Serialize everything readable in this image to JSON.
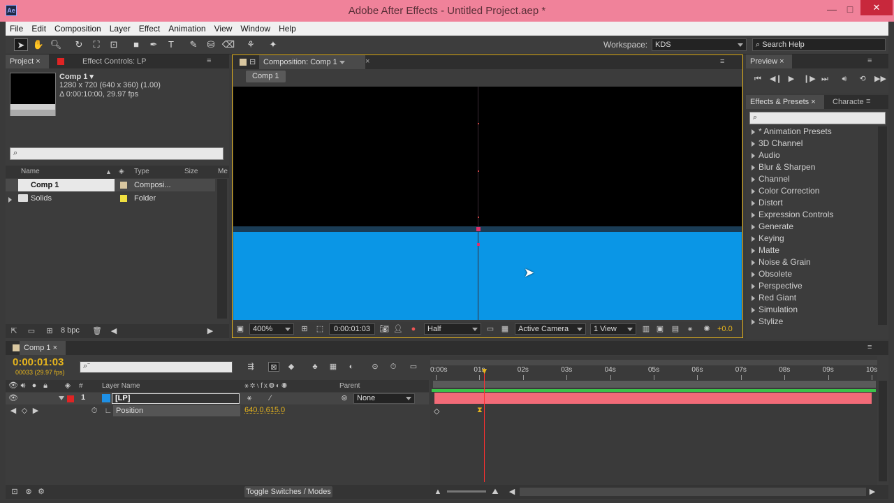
{
  "window": {
    "title": "Adobe After Effects - Untitled Project.aep *",
    "app_icon": "Ae"
  },
  "menu": [
    "File",
    "Edit",
    "Composition",
    "Layer",
    "Effect",
    "Animation",
    "View",
    "Window",
    "Help"
  ],
  "toolbar": {
    "workspace_label": "Workspace:",
    "workspace_value": "KDS",
    "search_placeholder": "Search Help"
  },
  "project_panel": {
    "tab_project": "Project",
    "tab_effect_controls": "Effect Controls: LP",
    "comp_name": "Comp 1 ▾",
    "comp_size": "1280 x 720  (640 x 360) (1.00)",
    "comp_duration": "Δ 0:00:10:00, 29.97 fps",
    "search_placeholder": "⌕",
    "columns": {
      "name": "Name",
      "type": "Type",
      "size": "Size",
      "media": "Me"
    },
    "items": [
      {
        "name": "Comp 1",
        "type": "Composi...",
        "label_color": "#d9c7a0"
      },
      {
        "name": "Solids",
        "type": "Folder",
        "label_color": "#f0e040"
      }
    ],
    "bpc": "8 bpc"
  },
  "composition_panel": {
    "tab": "Composition: Comp 1",
    "crumb": "Comp 1",
    "zoom": "400%",
    "timecode": "0:00:01:03",
    "resolution": "Half",
    "camera": "Active Camera",
    "views": "1 View",
    "exposure": "+0.0",
    "fill_color": "#0a96e6"
  },
  "preview_panel": {
    "tab": "Preview"
  },
  "effects_panel": {
    "tab": "Effects & Presets",
    "tab2": "Characte",
    "search_placeholder": "⌕",
    "items": [
      "* Animation Presets",
      "3D Channel",
      "Audio",
      "Blur & Sharpen",
      "Channel",
      "Color Correction",
      "Distort",
      "Expression Controls",
      "Generate",
      "Keying",
      "Matte",
      "Noise & Grain",
      "Obsolete",
      "Perspective",
      "Red Giant",
      "Simulation",
      "Stylize"
    ]
  },
  "timeline": {
    "tab": "Comp 1",
    "timecode": "0:00:01:03",
    "frame_info": "00033 (29.97 fps)",
    "columns": {
      "num": "#",
      "layer_name": "Layer Name",
      "parent": "Parent"
    },
    "layer": {
      "number": "1",
      "name": "[LP]",
      "parent": "None",
      "label_color": "#1e90e6"
    },
    "property": {
      "name": "Position",
      "value": "640.0,615.0"
    },
    "ticks": [
      "0:00s",
      "01s",
      "02s",
      "03s",
      "04s",
      "05s",
      "06s",
      "07s",
      "08s",
      "09s",
      "10s"
    ],
    "toggle_label": "Toggle Switches / Modes",
    "layer_bar_color": "#f26b78",
    "work_area_color": "#3cc24a",
    "playhead_time_s": 1.1
  },
  "colors": {
    "accent": "#e7b51d",
    "playhead": "#ff3030",
    "comp_bg": "#000000"
  }
}
